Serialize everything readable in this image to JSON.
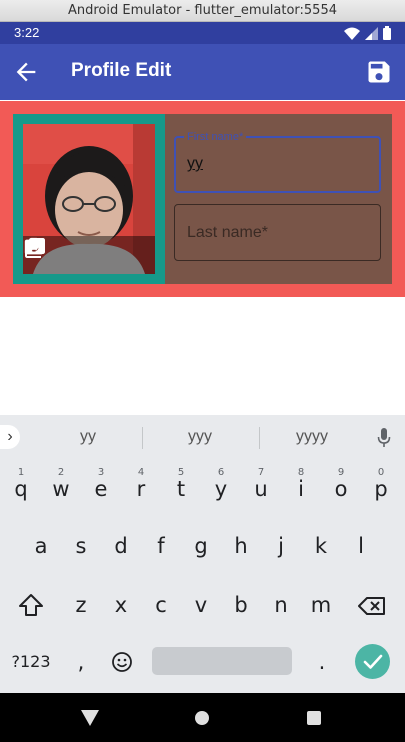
{
  "window": {
    "title": "Android Emulator - flutter_emulator:5554"
  },
  "status_bar": {
    "time": "3:22"
  },
  "app_bar": {
    "title": "Profile Edit"
  },
  "profile_form": {
    "first_name": {
      "label": "First name*",
      "value": "yy"
    },
    "last_name": {
      "placeholder": "Last name*",
      "value": ""
    }
  },
  "keyboard": {
    "suggestions": [
      "yy",
      "yyy",
      "yyyy"
    ],
    "row1": [
      {
        "key": "q",
        "hint": "1"
      },
      {
        "key": "w",
        "hint": "2"
      },
      {
        "key": "e",
        "hint": "3"
      },
      {
        "key": "r",
        "hint": "4"
      },
      {
        "key": "t",
        "hint": "5"
      },
      {
        "key": "y",
        "hint": "6"
      },
      {
        "key": "u",
        "hint": "7"
      },
      {
        "key": "i",
        "hint": "8"
      },
      {
        "key": "o",
        "hint": "9"
      },
      {
        "key": "p",
        "hint": "0"
      }
    ],
    "row2": [
      "a",
      "s",
      "d",
      "f",
      "g",
      "h",
      "j",
      "k",
      "l"
    ],
    "row3": [
      "z",
      "x",
      "c",
      "v",
      "b",
      "n",
      "m"
    ],
    "row4": {
      "symbols": "?123",
      "comma": ",",
      "period": "."
    }
  },
  "colors": {
    "app_bar": "#3f51b5",
    "status_bar": "#303f9f",
    "card_background": "#f25a56",
    "photo_frame": "#16998a",
    "fields_background": "#795548",
    "enter_key": "#4cb5a5"
  },
  "icons": {
    "back": "arrow-back-icon",
    "save": "save-icon",
    "camera": "camera-icon",
    "gallery": "image-icon",
    "mic": "mic-icon",
    "shift": "shift-icon",
    "backspace": "backspace-icon",
    "emoji": "emoji-icon",
    "enter": "check-icon"
  }
}
